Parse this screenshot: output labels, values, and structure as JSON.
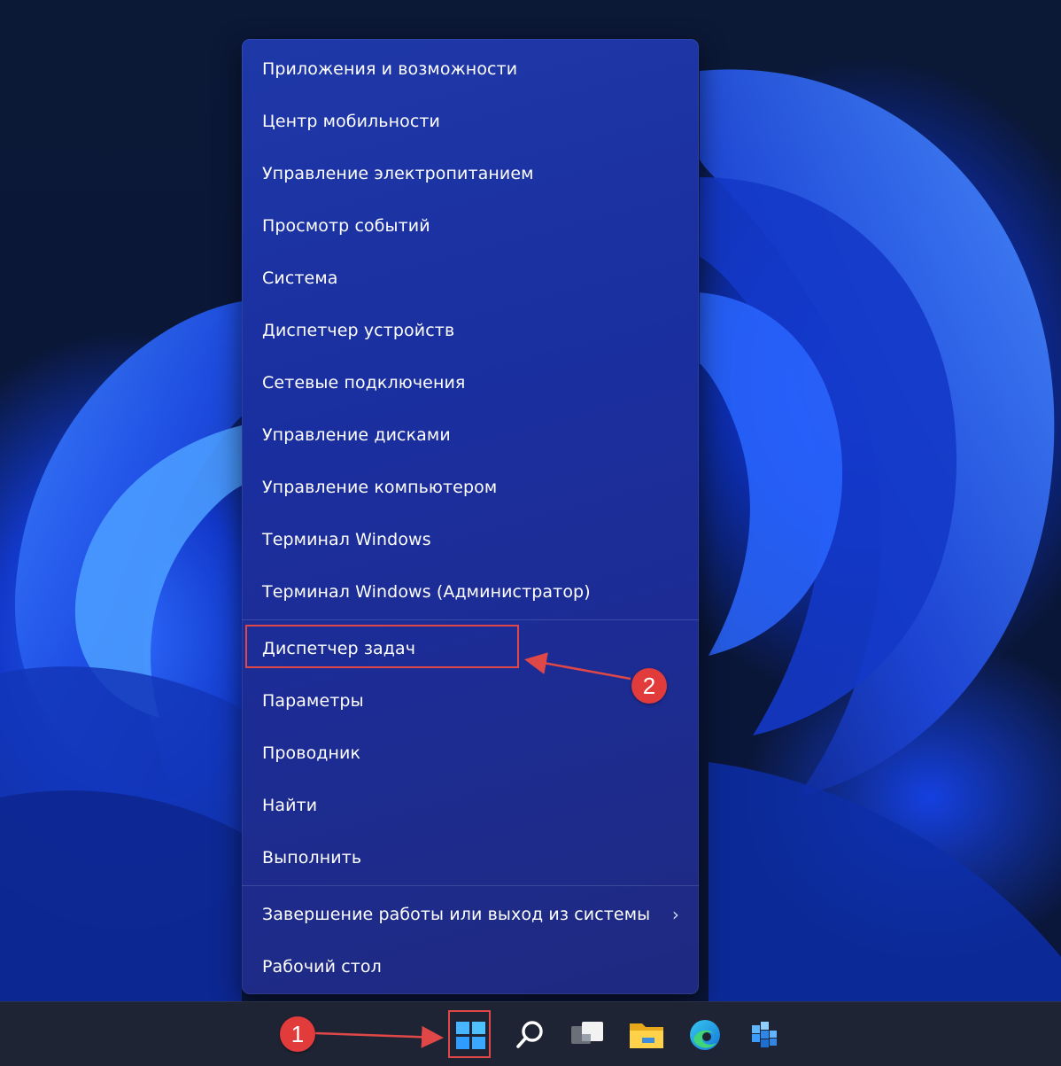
{
  "menu": {
    "items": [
      {
        "label": "Приложения и возможности"
      },
      {
        "label": "Центр мобильности"
      },
      {
        "label": "Управление электропитанием"
      },
      {
        "label": "Просмотр событий"
      },
      {
        "label": "Система"
      },
      {
        "label": "Диспетчер устройств"
      },
      {
        "label": "Сетевые подключения"
      },
      {
        "label": "Управление дисками"
      },
      {
        "label": "Управление компьютером"
      },
      {
        "label": "Терминал Windows"
      },
      {
        "label": "Терминал Windows (Администратор)"
      },
      {
        "label": "Диспетчер задач"
      },
      {
        "label": "Параметры"
      },
      {
        "label": "Проводник"
      },
      {
        "label": "Найти"
      },
      {
        "label": "Выполнить"
      },
      {
        "label": "Завершение работы или выход из системы",
        "submenu": "chevron-right-icon"
      },
      {
        "label": "Рабочий стол"
      }
    ],
    "submenu_glyph": "›"
  },
  "annotations": {
    "badge_1": "1",
    "badge_2": "2",
    "color": "#e04848"
  },
  "taskbar": {
    "icons": [
      "windows-start-icon",
      "search-icon",
      "task-view-icon",
      "file-explorer-icon",
      "edge-icon",
      "store-icon"
    ]
  }
}
